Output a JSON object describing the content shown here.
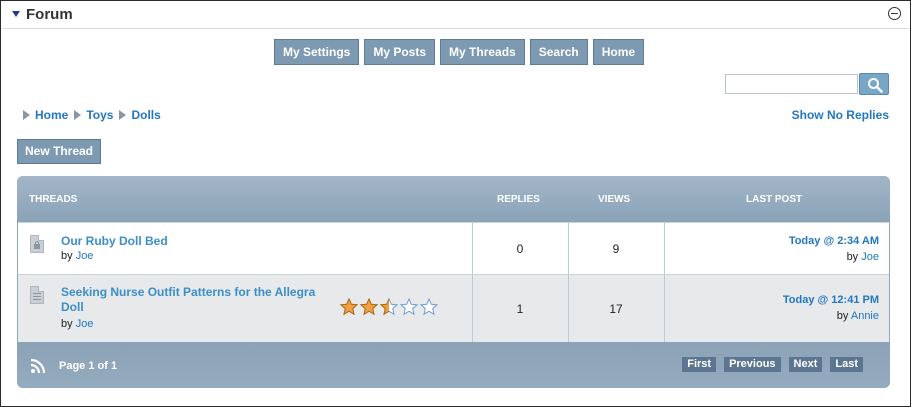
{
  "module": {
    "title": "Forum"
  },
  "nav": {
    "buttons": [
      "My Settings",
      "My Posts",
      "My Threads",
      "Search",
      "Home"
    ]
  },
  "search": {
    "value": "",
    "placeholder": ""
  },
  "breadcrumb": [
    "Home",
    "Toys",
    "Dolls"
  ],
  "show_no_replies": "Show No Replies",
  "new_thread": "New Thread",
  "table": {
    "headers": {
      "threads": "THREADS",
      "replies": "REPLIES",
      "views": "VIEWS",
      "last_post": "LAST POST"
    },
    "rows": [
      {
        "title": "Our Ruby Doll Bed",
        "by_label": "by",
        "author": "Joe",
        "replies": "0",
        "views": "9",
        "last_time": "Today @ 2:34 AM",
        "last_by_label": "by",
        "last_author": "Joe",
        "icon": "locked-document-icon"
      },
      {
        "title_line1": "Seeking Nurse Outfit Patterns for the Allegra",
        "title_line2": "Doll",
        "by_label": "by",
        "author": "Joe",
        "replies": "1",
        "views": "17",
        "last_time": "Today @ 12:41 PM",
        "last_by_label": "by",
        "last_author": "Annie",
        "rating": 2.5,
        "rating_max": 5,
        "icon": "document-icon"
      }
    ]
  },
  "footer": {
    "page_info": "Page 1 of 1",
    "pager": [
      "First",
      "Previous",
      "Next",
      "Last"
    ]
  },
  "colors": {
    "button_bg": "#7e9ab2",
    "link": "#2277c2",
    "star_fill": "#f0a040",
    "header_bg": "#8fa6bb"
  }
}
